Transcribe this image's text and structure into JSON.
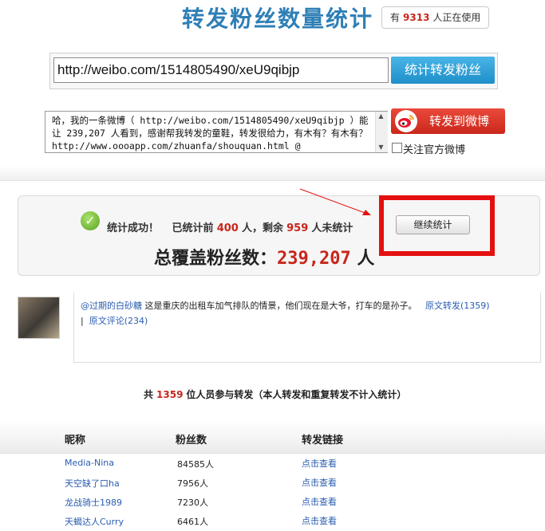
{
  "header": {
    "title": "转发粉丝数量统计",
    "online_prefix": "有",
    "online_count": "9313",
    "online_suffix": "人正在使用"
  },
  "url_form": {
    "url_value": "http://weibo.com/1514805490/xeU9qibjp",
    "count_button": "统计转发粉丝"
  },
  "share": {
    "weibo_text": "哈，我的一条微博（ http://weibo.com/1514805490/xeU9qibjp ）能让 239,207 人看到，感谢帮我转发的童鞋，转发很给力，有木有？有木有？http://www.oooapp.com/zhuanfa/shouquan.html @",
    "share_button": "转发到微博",
    "follow_label": "关注官方微博"
  },
  "result": {
    "success_text": "统计成功！",
    "counted_prefix": "已统计前",
    "counted": "400",
    "counted_mid": "人，剩余",
    "remaining": "959",
    "remaining_suffix": "人未统计",
    "total_label": "总覆盖粉丝数：",
    "total_value": "239,207",
    "total_unit": "人",
    "continue_button": "继续统计"
  },
  "post": {
    "author": "@过期的白砂糖",
    "content": "这是重庆的出租车加气排队的情景，他们现在是大爷，打车的是孙子。",
    "repost_link": "原文转发(1359)",
    "separator": "|",
    "comment_link": "原文评论(234)"
  },
  "summary": {
    "prefix": "共",
    "count": "1359",
    "suffix": "位人员参与转发（本人转发和重复转发不计入统计）"
  },
  "table": {
    "headers": [
      "昵称",
      "粉丝数",
      "转发链接"
    ],
    "rows": [
      {
        "nick": "Media-Nina",
        "fans": "84585人",
        "link": "点击查看"
      },
      {
        "nick": "天空缺了口ha",
        "fans": "7956人",
        "link": "点击查看"
      },
      {
        "nick": "龙战骑士1989",
        "fans": "7230人",
        "link": "点击查看"
      },
      {
        "nick": "天蝎达人Curry",
        "fans": "6461人",
        "link": "点击查看"
      }
    ]
  },
  "colors": {
    "accent_blue": "#2f7fb6",
    "highlight_red": "#c8261c",
    "annotation_red": "#e41010"
  }
}
